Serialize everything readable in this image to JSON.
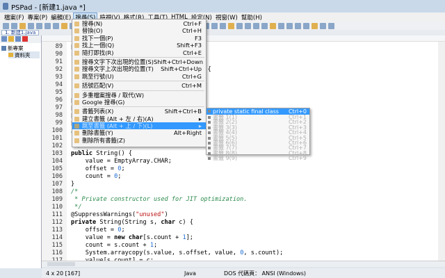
{
  "window": {
    "title": "PSPad - [新建1.java *]"
  },
  "menubar": [
    "檔案(F)",
    "專案(P)",
    "編輯(E)",
    "搜尋(S)",
    "檢視(V)",
    "格式(R)",
    "工具(T)",
    "HTML",
    "設定(N)",
    "視窗(W)",
    "幫助(H)"
  ],
  "tab": {
    "label": "1. 新建1.java"
  },
  "project_tree": {
    "root": "新專案",
    "folder": "資料夾"
  },
  "search_menu": [
    {
      "label": "搜尋(N)",
      "shortcut": "Ctrl+F"
    },
    {
      "label": "替換(O)",
      "shortcut": "Ctrl+H"
    },
    {
      "label": "找下一個(P)",
      "shortcut": "F3"
    },
    {
      "label": "找上一個(Q)",
      "shortcut": "Shift+F3"
    },
    {
      "label": "隨打即找(R)",
      "shortcut": "Ctrl+E",
      "sep": true
    },
    {
      "label": "搜尋文字下次出現的位置(S)",
      "shortcut": "Shift+Ctrl+Down"
    },
    {
      "label": "搜尋文字上次出現的位置(T)",
      "shortcut": "Shift+Ctrl+Up"
    },
    {
      "label": "跳至行號(U)",
      "shortcut": "Ctrl+G",
      "sep": true
    },
    {
      "label": "括號匹配(V)",
      "shortcut": "Ctrl+M",
      "sep": true
    },
    {
      "label": "多重檔案搜尋 / 取代(W)",
      "shortcut": ""
    },
    {
      "label": "Google 搜尋(G)",
      "shortcut": "",
      "sep": true
    },
    {
      "label": "書籤列表(X)",
      "shortcut": "Shift+Ctrl+B"
    },
    {
      "label": "建立書籤 (Alt + 左 / 右)(A)",
      "shortcut": "▸"
    },
    {
      "label": "跳至書籤 (Alt + 上 / 下)(L)",
      "shortcut": "▸",
      "highlighted": true
    },
    {
      "label": "刪除書籤(Y)",
      "shortcut": "Alt+Right"
    },
    {
      "label": "刪除所有書籤(Z)",
      "shortcut": ""
    }
  ],
  "bookmark_submenu": [
    {
      "label": "private static final class Cas",
      "shortcut": "Ctrl+0",
      "highlighted": true
    },
    {
      "label": "書籤 1(1)",
      "shortcut": "Ctrl+1"
    },
    {
      "label": "書籤 2(2)",
      "shortcut": "Ctrl+2"
    },
    {
      "label": "書籤 3(3)",
      "shortcut": "Ctrl+3"
    },
    {
      "label": "書籤 4(4)",
      "shortcut": "Ctrl+4"
    },
    {
      "label": "書籤 5(5)",
      "shortcut": "Ctrl+5"
    },
    {
      "label": "書籤 6(6)",
      "shortcut": "Ctrl+6"
    },
    {
      "label": "書籤 7(7)",
      "shortcut": "Ctrl+7"
    },
    {
      "label": "書籤 8(8)",
      "shortcut": "Ctrl+8"
    },
    {
      "label": "書籤 9(9)",
      "shortcut": "Ctrl+9"
    }
  ],
  "code_lines": [
    {
      "n": "89",
      "t": [
        [
          "p",
          ""
        ]
      ]
    },
    {
      "n": "90",
      "t": [
        [
          "s",
          ""
        ]
      ]
    },
    {
      "n": "91",
      "t": []
    },
    {
      "n": "92",
      "t": [
        [
          "                                  +i) {",
          ""
        ]
      ]
    },
    {
      "n": "93",
      "t": []
    },
    {
      "n": "94",
      "t": []
    },
    {
      "n": "95",
      "t": [
        [
          "}",
          ""
        ]
      ]
    },
    {
      "n": "96",
      "t": [
        [
          "p",
          ""
        ]
      ]
    },
    {
      "n": "97",
      "t": [
        [
          "p",
          ""
        ]
      ]
    },
    {
      "n": "98",
      "t": [
        [
          "p",
          ""
        ]
      ]
    },
    {
      "n": "99",
      "t": [
        [
          "p",
          ""
        ]
      ]
    },
    {
      "n": "100",
      "t": [
        [
          "/",
          "cm"
        ]
      ]
    },
    {
      "n": "101",
      "t": [
        [
          " * Creates an empty string.",
          "cm"
        ]
      ]
    },
    {
      "n": "102",
      "t": [
        [
          " */",
          "cm"
        ]
      ]
    },
    {
      "n": "103",
      "t": [
        [
          "public",
          "kw"
        ],
        [
          " String() {",
          ""
        ]
      ]
    },
    {
      "n": "104",
      "t": [
        [
          "    value = EmptyArray.CHAR;",
          ""
        ]
      ]
    },
    {
      "n": "105",
      "t": [
        [
          "    offset = ",
          ""
        ],
        [
          "0",
          "num"
        ],
        [
          ";",
          ""
        ]
      ]
    },
    {
      "n": "106",
      "t": [
        [
          "    count = ",
          ""
        ],
        [
          "0",
          "num"
        ],
        [
          ";",
          ""
        ]
      ]
    },
    {
      "n": "107",
      "t": [
        [
          "}",
          ""
        ]
      ]
    },
    {
      "n": "108",
      "t": [
        [
          "/*",
          "cm"
        ]
      ]
    },
    {
      "n": "109",
      "t": [
        [
          " * Private constructor used for JIT optimization.",
          "cm"
        ]
      ]
    },
    {
      "n": "110",
      "t": [
        [
          " */",
          "cm"
        ]
      ]
    },
    {
      "n": "111",
      "t": [
        [
          "@SuppressWarnings(",
          ""
        ],
        [
          "\"unused\"",
          "str"
        ],
        [
          ")",
          ""
        ]
      ]
    },
    {
      "n": "112",
      "t": [
        [
          "private",
          "kw"
        ],
        [
          " String(String s, ",
          ""
        ],
        [
          "char",
          "kw"
        ],
        [
          " c) {",
          ""
        ]
      ]
    },
    {
      "n": "113",
      "t": [
        [
          "    offset = ",
          ""
        ],
        [
          "0",
          "num"
        ],
        [
          ";",
          ""
        ]
      ]
    },
    {
      "n": "114",
      "t": [
        [
          "    value = ",
          ""
        ],
        [
          "new",
          "kw"
        ],
        [
          " ",
          ""
        ],
        [
          "char",
          "kw"
        ],
        [
          "[s.count + ",
          ""
        ],
        [
          "1",
          "num"
        ],
        [
          "];",
          ""
        ]
      ]
    },
    {
      "n": "115",
      "t": [
        [
          "    count = s.count + ",
          ""
        ],
        [
          "1",
          "num"
        ],
        [
          ";",
          ""
        ]
      ]
    },
    {
      "n": "116",
      "t": [
        [
          "    System.arraycopy(s.value, s.offset, value, ",
          ""
        ],
        [
          "0",
          "num"
        ],
        [
          ", s.count);",
          ""
        ]
      ]
    },
    {
      "n": "117",
      "t": [
        [
          "    value[s.count] = c;",
          ""
        ]
      ]
    }
  ],
  "status": {
    "position": "4 x 20  [167]",
    "syntax": "Java",
    "encoding": "DOS 代碼頁： ANSI (Windows)"
  },
  "colors": {
    "highlight": "#3399ff",
    "comment": "#2a8a4a",
    "string": "#b11111",
    "number": "#1a6ad0"
  }
}
